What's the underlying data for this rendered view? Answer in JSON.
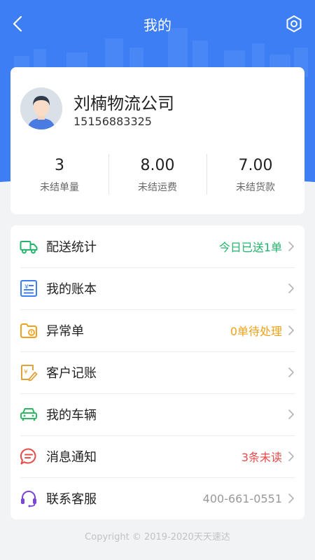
{
  "nav": {
    "title": "我的"
  },
  "profile": {
    "company": "刘楠物流公司",
    "phone": "15156883325"
  },
  "stats": [
    {
      "value": "3",
      "label": "未结单量"
    },
    {
      "value": "8.00",
      "label": "未结运费"
    },
    {
      "value": "7.00",
      "label": "未结货款"
    }
  ],
  "menu": [
    {
      "label": "配送统计",
      "value": "今日已送1单",
      "icon": "delivery-truck-icon",
      "color": "#23b56b"
    },
    {
      "label": "我的账本",
      "value": "",
      "icon": "ledger-icon",
      "color": "#3d7ef5"
    },
    {
      "label": "异常单",
      "value": "0单待处理",
      "icon": "exception-order-icon",
      "color": "#f0a11a"
    },
    {
      "label": "客户记账",
      "value": "",
      "icon": "customer-bookkeeping-icon",
      "color": "#e0a23a"
    },
    {
      "label": "我的车辆",
      "value": "",
      "icon": "vehicle-icon",
      "color": "#2fb864"
    },
    {
      "label": "消息通知",
      "value": "3条未读",
      "icon": "message-icon",
      "color": "#e94a4a"
    },
    {
      "label": "联系客服",
      "value": "400-661-0551",
      "icon": "customer-service-icon",
      "color": "#7a45d8"
    }
  ],
  "colors": {
    "primary": "#3d7ef5",
    "value_grey": "#999999"
  },
  "footer": {
    "copyright": "Copyright © 2019-2020天天速达"
  }
}
